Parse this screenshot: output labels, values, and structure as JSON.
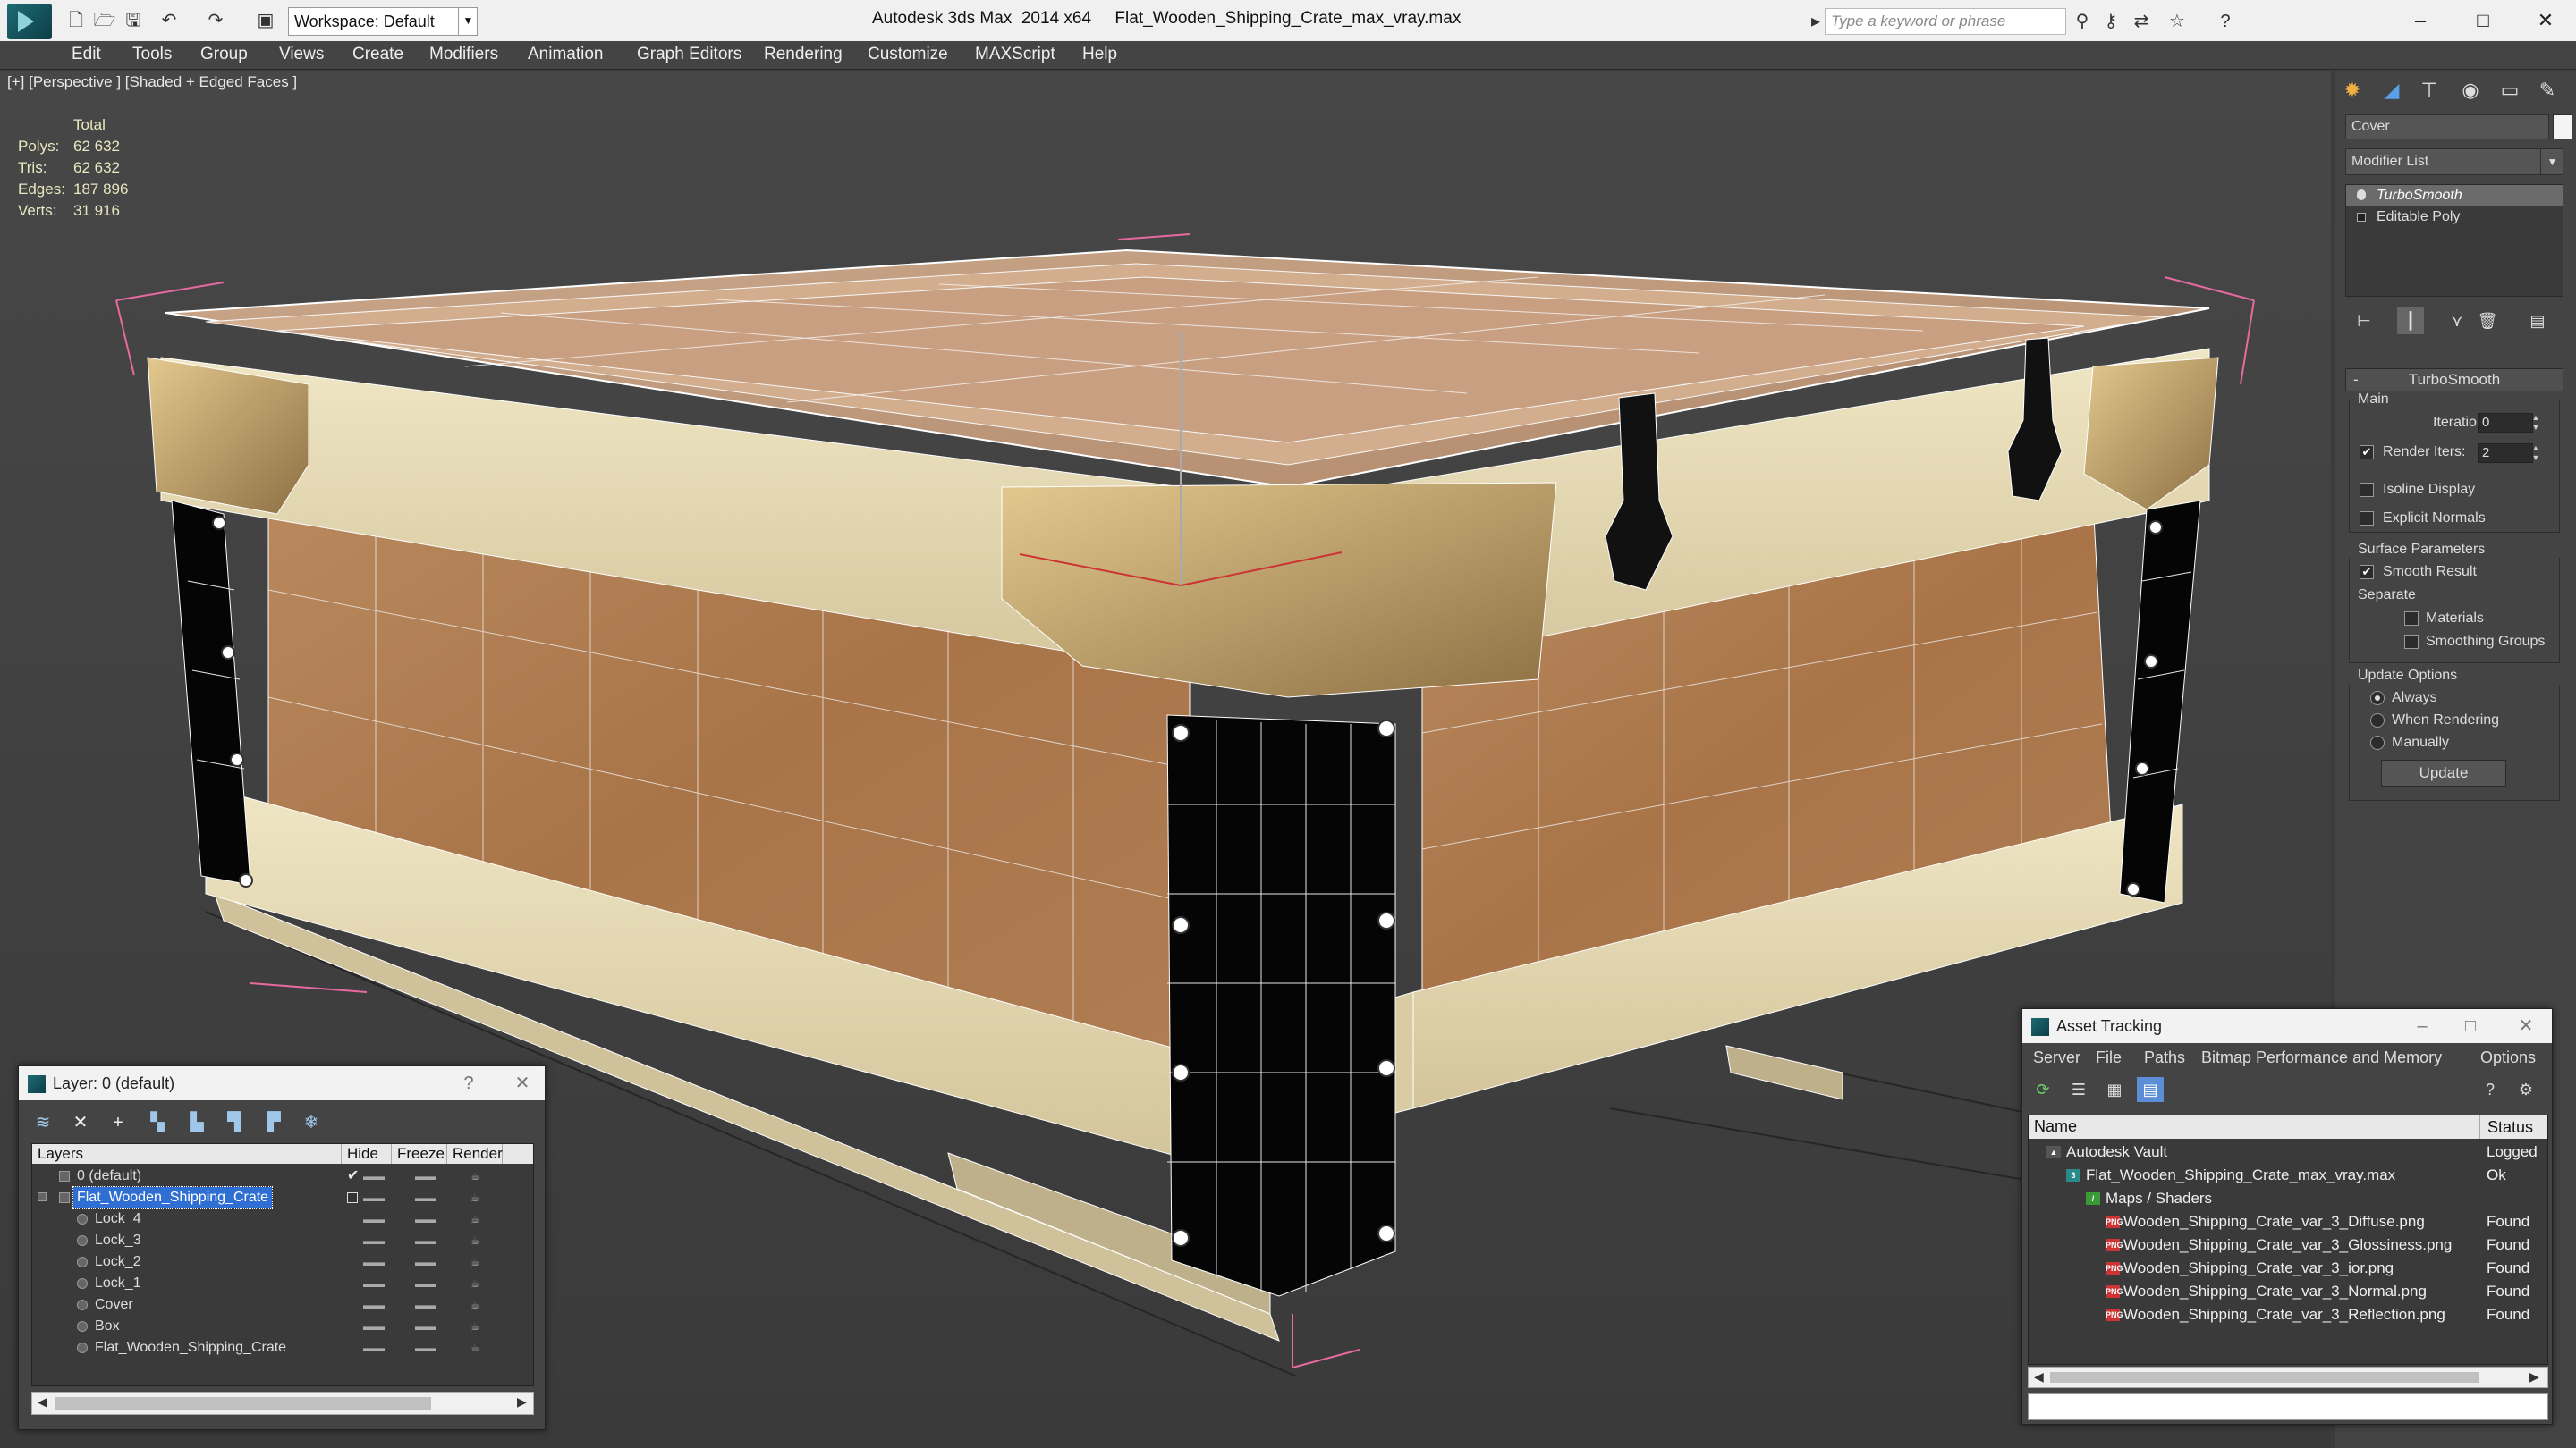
{
  "titlebar": {
    "app_title": "Autodesk 3ds Max  2014 x64     Flat_Wooden_Shipping_Crate_max_vray.max",
    "workspace": "Workspace: Default",
    "search_placeholder": "Type a keyword or phrase",
    "minimize": "–",
    "maximize": "□",
    "close": "✕"
  },
  "menu": [
    "Edit",
    "Tools",
    "Group",
    "Views",
    "Create",
    "Modifiers",
    "Animation",
    "Graph Editors",
    "Rendering",
    "Customize",
    "MAXScript",
    "Help"
  ],
  "viewport": {
    "label": "[+] [Perspective ] [Shaded + Edged Faces ]",
    "stats_header": "Total",
    "stats": [
      {
        "key": "Polys:",
        "value": "62 632"
      },
      {
        "key": "Tris:",
        "value": "62 632"
      },
      {
        "key": "Edges:",
        "value": "187 896"
      },
      {
        "key": "Verts:",
        "value": "31 916"
      }
    ]
  },
  "command_panel": {
    "object_name": "Cover",
    "modifier_list": "Modifier List",
    "stack": [
      "TurboSmooth",
      "Editable Poly"
    ],
    "rollout_title": "TurboSmooth",
    "main_group": "Main",
    "iterations_label": "Iterations:",
    "iterations_value": "0",
    "render_iters_label": "Render Iters:",
    "render_iters_value": "2",
    "render_iters_checked": "✔",
    "isoline_display": "Isoline Display",
    "explicit_normals": "Explicit Normals",
    "surface_params_group": "Surface Parameters",
    "smooth_result": "Smooth Result",
    "smooth_result_checked": "✔",
    "separate_label": "Separate",
    "materials": "Materials",
    "smoothing_groups": "Smoothing Groups",
    "update_options_group": "Update Options",
    "always": "Always",
    "when_rendering": "When Rendering",
    "manually": "Manually",
    "update_button": "Update"
  },
  "layer_dialog": {
    "title": "Layer: 0 (default)",
    "help": "?",
    "close": "✕",
    "columns": {
      "layers": "Layers",
      "hide": "Hide",
      "freeze": "Freeze",
      "render": "Render"
    },
    "rows": [
      {
        "name": "0 (default)",
        "level": 0,
        "checked": "✔"
      },
      {
        "name": "Flat_Wooden_Shipping_Crate",
        "level": 0,
        "selected": true
      },
      {
        "name": "Lock_4",
        "level": 1
      },
      {
        "name": "Lock_3",
        "level": 1
      },
      {
        "name": "Lock_2",
        "level": 1
      },
      {
        "name": "Lock_1",
        "level": 1
      },
      {
        "name": "Cover",
        "level": 1
      },
      {
        "name": "Box",
        "level": 1
      },
      {
        "name": "Flat_Wooden_Shipping_Crate",
        "level": 1
      }
    ]
  },
  "asset_tracking": {
    "title": "Asset Tracking",
    "menu": [
      "Server",
      "File",
      "Paths",
      "Bitmap Performance and Memory",
      "Options"
    ],
    "columns": {
      "name": "Name",
      "status": "Status"
    },
    "rows": [
      {
        "name": "Autodesk Vault",
        "status": "Logged O",
        "level": 0,
        "icon": "vault-icon"
      },
      {
        "name": "Flat_Wooden_Shipping_Crate_max_vray.max",
        "status": "Ok",
        "level": 1,
        "icon": "max-file-icon"
      },
      {
        "name": "Maps / Shaders",
        "status": "",
        "level": 2,
        "icon": "maps-icon"
      },
      {
        "name": "Wooden_Shipping_Crate_var_3_Diffuse.png",
        "status": "Found",
        "level": 3,
        "icon": "png-icon"
      },
      {
        "name": "Wooden_Shipping_Crate_var_3_Glossiness.png",
        "status": "Found",
        "level": 3,
        "icon": "png-icon"
      },
      {
        "name": "Wooden_Shipping_Crate_var_3_ior.png",
        "status": "Found",
        "level": 3,
        "icon": "png-icon"
      },
      {
        "name": "Wooden_Shipping_Crate_var_3_Normal.png",
        "status": "Found",
        "level": 3,
        "icon": "png-icon"
      },
      {
        "name": "Wooden_Shipping_Crate_var_3_Reflection.png",
        "status": "Found",
        "level": 3,
        "icon": "png-icon"
      }
    ]
  }
}
